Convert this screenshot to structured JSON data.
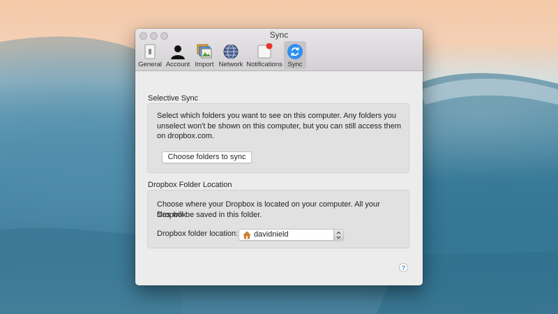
{
  "window": {
    "title": "Sync"
  },
  "toolbar": {
    "tabs": [
      {
        "label": "General",
        "icon": "switch-icon"
      },
      {
        "label": "Account",
        "icon": "person-icon"
      },
      {
        "label": "Import",
        "icon": "photos-icon"
      },
      {
        "label": "Network",
        "icon": "globe-icon"
      },
      {
        "label": "Notifications",
        "icon": "notification-badge-icon"
      },
      {
        "label": "Sync",
        "icon": "sync-icon",
        "selected": true
      }
    ]
  },
  "selective_sync": {
    "heading": "Selective Sync",
    "line1": "Select which folders you want to see on this computer. Any folders you",
    "line2": "unselect won't be shown on this computer, but you can still access them",
    "line3": "on dropbox.com.",
    "button_label": "Choose folders to sync"
  },
  "folder_location": {
    "heading": "Dropbox Folder Location",
    "line1": "Choose where your Dropbox is located on your computer. All your Dropbox",
    "line2": "files will be saved in this folder.",
    "field_label": "Dropbox folder location:",
    "selected_value": "davidnield"
  },
  "help": {
    "symbol": "?"
  },
  "colors": {
    "accent": "#2f8ff0",
    "badge": "#e5372c"
  }
}
